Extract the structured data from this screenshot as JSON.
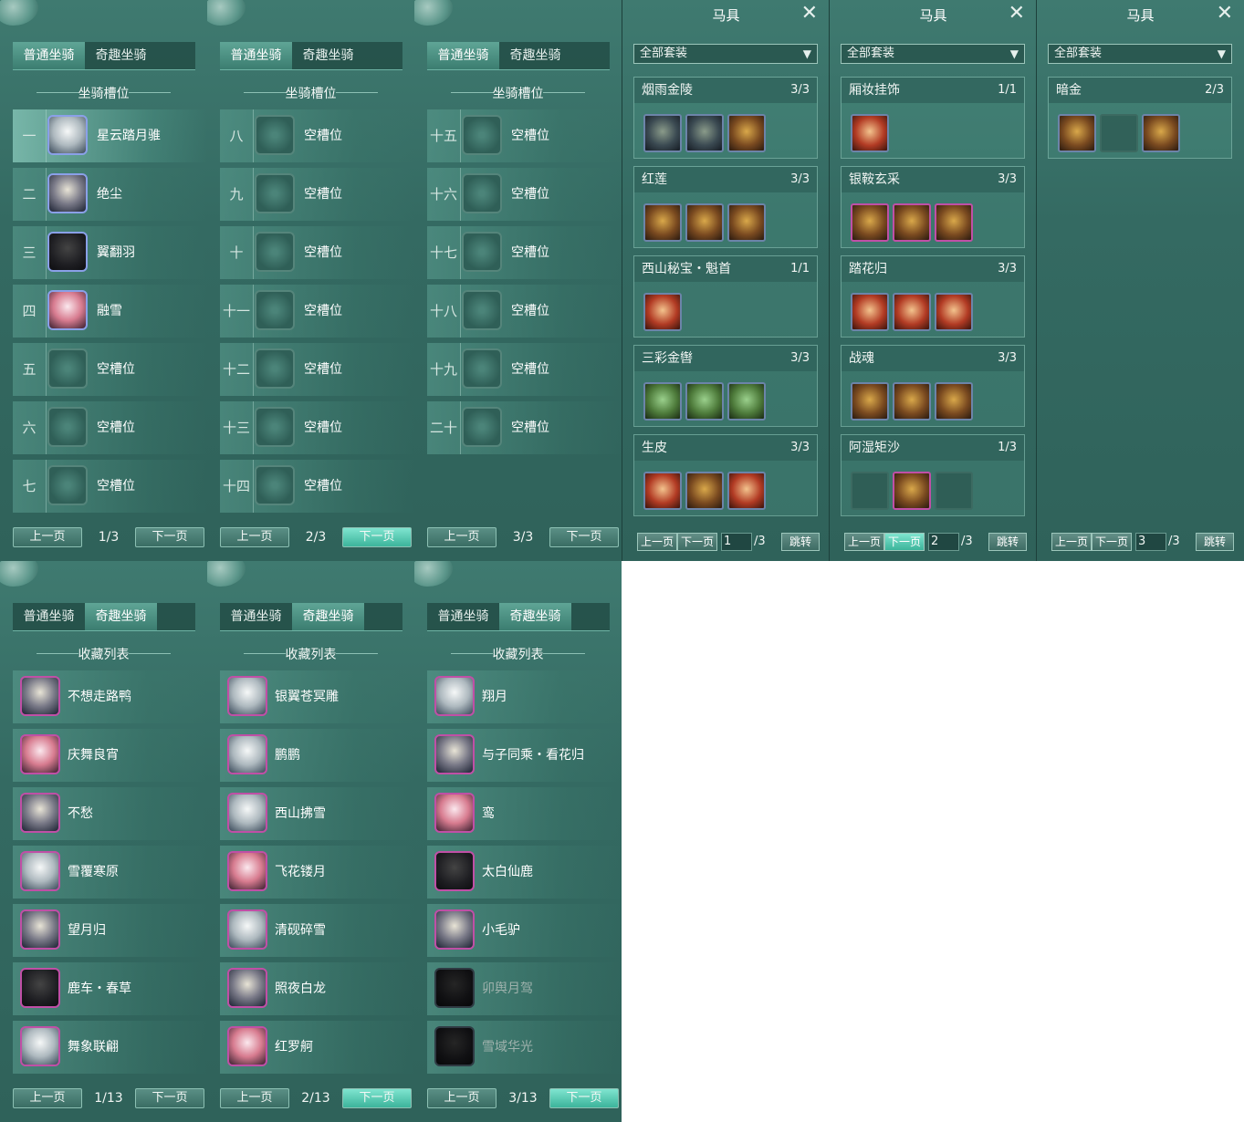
{
  "tabs": {
    "normal": "普通坐骑",
    "fun": "奇趣坐骑"
  },
  "slot_title": "坐骑槽位",
  "collection_title": "收藏列表",
  "prev": "上一页",
  "next": "下一页",
  "slot_pages": [
    {
      "page": "1/3",
      "rows": [
        {
          "num": "一",
          "name": "星云踏月骓"
        },
        {
          "num": "二",
          "name": "绝尘"
        },
        {
          "num": "三",
          "name": "翼翻羽"
        },
        {
          "num": "四",
          "name": "融雪"
        },
        {
          "num": "五",
          "name": "空槽位"
        },
        {
          "num": "六",
          "name": "空槽位"
        },
        {
          "num": "七",
          "name": "空槽位"
        }
      ]
    },
    {
      "page": "2/3",
      "rows": [
        {
          "num": "八",
          "name": "空槽位"
        },
        {
          "num": "九",
          "name": "空槽位"
        },
        {
          "num": "十",
          "name": "空槽位"
        },
        {
          "num": "十一",
          "name": "空槽位"
        },
        {
          "num": "十二",
          "name": "空槽位"
        },
        {
          "num": "十三",
          "name": "空槽位"
        },
        {
          "num": "十四",
          "name": "空槽位"
        }
      ]
    },
    {
      "page": "3/3",
      "rows": [
        {
          "num": "十五",
          "name": "空槽位"
        },
        {
          "num": "十六",
          "name": "空槽位"
        },
        {
          "num": "十七",
          "name": "空槽位"
        },
        {
          "num": "十八",
          "name": "空槽位"
        },
        {
          "num": "十九",
          "name": "空槽位"
        },
        {
          "num": "二十",
          "name": "空槽位"
        }
      ]
    }
  ],
  "collection_pages": [
    {
      "page": "1/13",
      "rows": [
        {
          "name": "不想走路鸭"
        },
        {
          "name": "庆舞良宵"
        },
        {
          "name": "不愁"
        },
        {
          "name": "雪覆寒原"
        },
        {
          "name": "望月归"
        },
        {
          "name": "鹿车・春草"
        },
        {
          "name": "舞象联翩"
        }
      ]
    },
    {
      "page": "2/13",
      "rows": [
        {
          "name": "银翼苍冥雕"
        },
        {
          "name": "鹏鹏"
        },
        {
          "name": "西山拂雪"
        },
        {
          "name": "飞花镂月"
        },
        {
          "name": "清砚碎雪"
        },
        {
          "name": "照夜白龙"
        },
        {
          "name": "红罗舸"
        }
      ]
    },
    {
      "page": "3/13",
      "rows": [
        {
          "name": "翔月"
        },
        {
          "name": "与子同乘・看花归"
        },
        {
          "name": "鸾"
        },
        {
          "name": "太白仙鹿"
        },
        {
          "name": "小毛驴"
        },
        {
          "name": "卯舆月驾"
        },
        {
          "name": "雪域华光"
        }
      ]
    }
  ],
  "gear": {
    "title": "马具",
    "filter": "全部套装",
    "jump": "跳转",
    "pages": [
      {
        "page": "1",
        "total": "/3",
        "sets": [
          {
            "name": "烟雨金陵",
            "count": "3/3"
          },
          {
            "name": "红莲",
            "count": "3/3"
          },
          {
            "name": "西山秘宝・魁首",
            "count": "1/1"
          },
          {
            "name": "三彩金辔",
            "count": "3/3"
          },
          {
            "name": "生皮",
            "count": "3/3"
          }
        ]
      },
      {
        "page": "2",
        "total": "/3",
        "sets": [
          {
            "name": "厢妆挂饰",
            "count": "1/1"
          },
          {
            "name": "银鞍玄采",
            "count": "3/3"
          },
          {
            "name": "踏花归",
            "count": "3/3"
          },
          {
            "name": "战魂",
            "count": "3/3"
          },
          {
            "name": "阿湿矩沙",
            "count": "1/3"
          }
        ]
      },
      {
        "page": "3",
        "total": "/3",
        "sets": [
          {
            "name": "暗金",
            "count": "2/3"
          }
        ]
      }
    ]
  }
}
